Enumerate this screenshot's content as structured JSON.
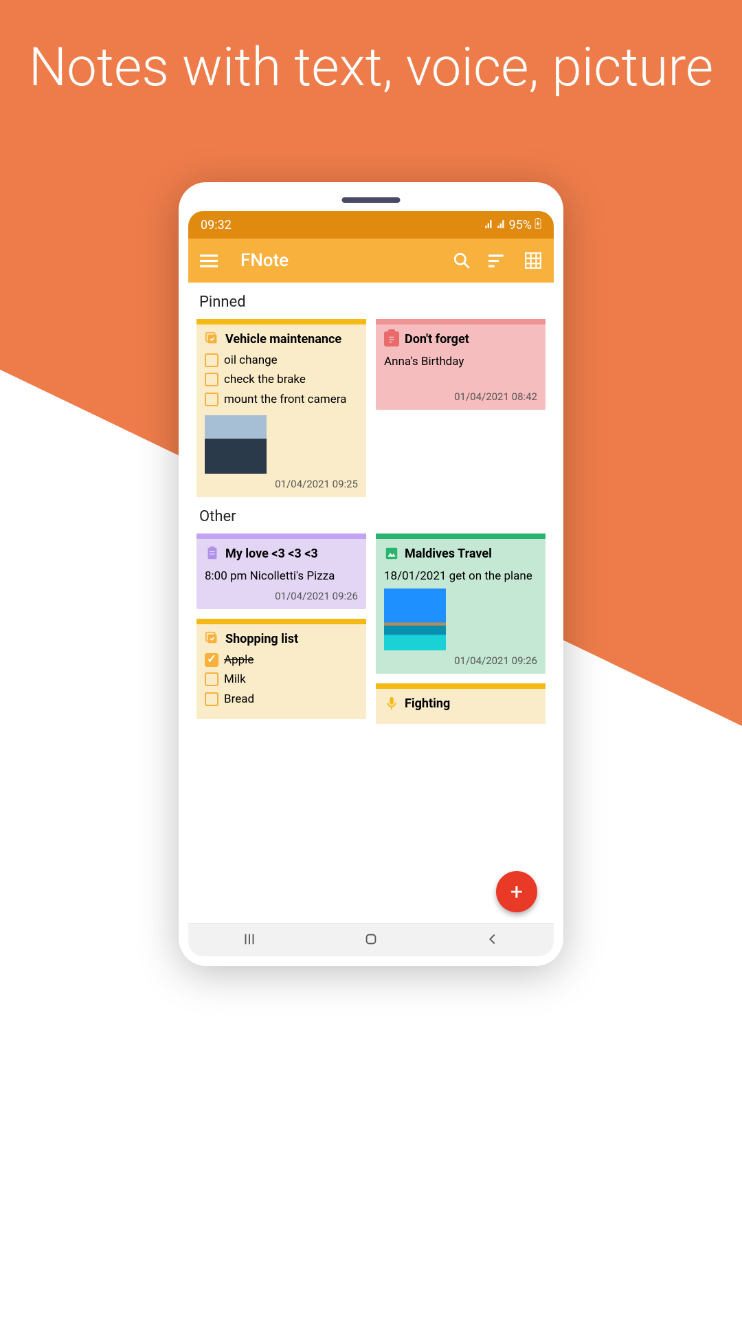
{
  "hero": "Notes with text, voice, picture",
  "status": {
    "time": "09:32",
    "battery": "95%"
  },
  "appBar": {
    "title": "FNote"
  },
  "sections": {
    "pinned": "Pinned",
    "other": "Other"
  },
  "notes": {
    "vehicle": {
      "title": "Vehicle maintenance",
      "items": [
        "oil change",
        "check the brake",
        "mount the front camera"
      ],
      "date": "01/04/2021 09:25",
      "color": {
        "stripe": "#f5b915",
        "bg": "#faecc9"
      }
    },
    "dontForget": {
      "title": "Don't forget",
      "body": "Anna's Birthday",
      "date": "01/04/2021 08:42",
      "color": {
        "stripe": "#ef9494",
        "bg": "#f5bdbd"
      }
    },
    "myLove": {
      "title": "My love <3 <3 <3",
      "body": "8:00 pm Nicolletti's Pizza",
      "date": "01/04/2021 09:26",
      "color": {
        "stripe": "#c1a4f2",
        "bg": "#e3d6f5"
      }
    },
    "maldives": {
      "title": "Maldives Travel",
      "body": "18/01/2021 get on the plane",
      "date": "01/04/2021 09:26",
      "color": {
        "stripe": "#29b56d",
        "bg": "#c4e8d4"
      }
    },
    "shopping": {
      "title": "Shopping list",
      "items": [
        {
          "label": "Apple",
          "done": true
        },
        {
          "label": "Milk",
          "done": false
        },
        {
          "label": "Bread",
          "done": false
        }
      ],
      "color": {
        "stripe": "#f5b915",
        "bg": "#faecc9"
      }
    },
    "fighting": {
      "title": "Fighting",
      "color": {
        "stripe": "#f5b915",
        "bg": "#faecc9"
      }
    }
  },
  "iconColors": {
    "checklist": "#f8b13d",
    "clipboardRed": "#e96a6a",
    "clipboardPurple": "#b090e8",
    "image": "#29b56d",
    "mic": "#f5b915"
  }
}
